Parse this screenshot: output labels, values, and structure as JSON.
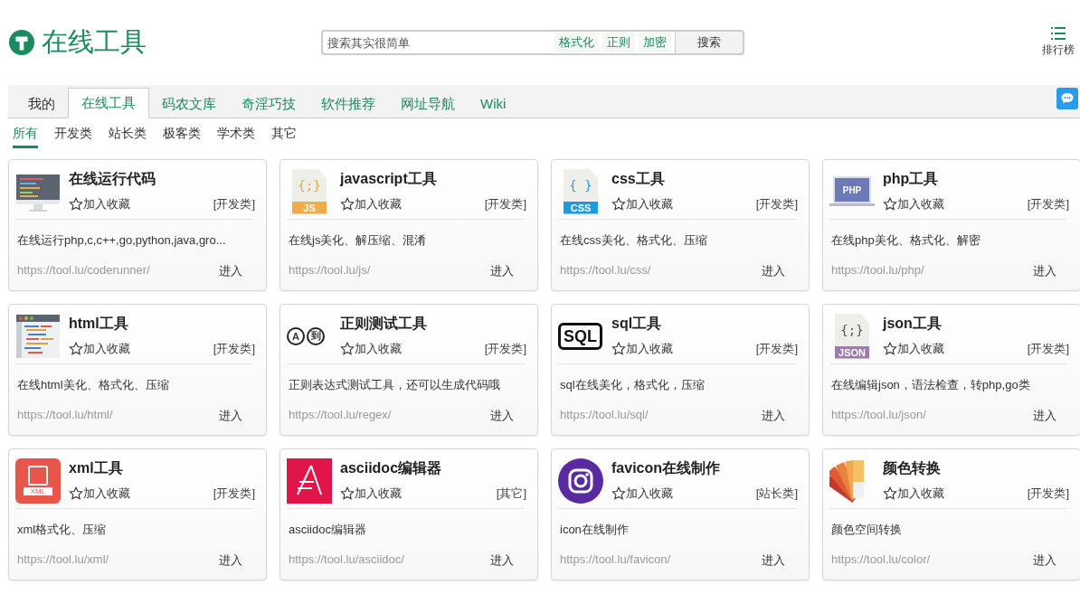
{
  "logo": {
    "title": "在线工具"
  },
  "search": {
    "placeholder": "搜索其实很简单",
    "tags": [
      "格式化",
      "正则",
      "加密"
    ],
    "button": "搜索"
  },
  "ranking": {
    "label": "排行榜"
  },
  "tabs": [
    {
      "label": "我的",
      "selected": false
    },
    {
      "label": "在线工具",
      "selected": true
    },
    {
      "label": "码农文库",
      "selected": false
    },
    {
      "label": "奇淫巧技",
      "selected": false
    },
    {
      "label": "软件推荐",
      "selected": false
    },
    {
      "label": "网址导航",
      "selected": false
    },
    {
      "label": "Wiki",
      "selected": false
    }
  ],
  "filters": [
    {
      "label": "所有",
      "selected": true
    },
    {
      "label": "开发类",
      "selected": false
    },
    {
      "label": "站长类",
      "selected": false
    },
    {
      "label": "极客类",
      "selected": false
    },
    {
      "label": "学术类",
      "selected": false
    },
    {
      "label": "其它",
      "selected": false
    }
  ],
  "cards": [
    {
      "title": "在线运行代码",
      "favorite": "加入收藏",
      "category": "[开发类]",
      "description": "在线运行php,c,c++,go,python,java,gro...",
      "url": "https://tool.lu/coderunner/",
      "enter": "进入"
    },
    {
      "title": "javascript工具",
      "icon_labels": [
        "{;}",
        "JS"
      ],
      "favorite": "加入收藏",
      "category": "[开发类]",
      "description": "在线js美化、解压缩、混淆",
      "url": "https://tool.lu/js/",
      "enter": "进入"
    },
    {
      "title": "css工具",
      "icon_labels": [
        "{ }",
        "CSS"
      ],
      "favorite": "加入收藏",
      "category": "[开发类]",
      "description": "在线css美化、格式化、压缩",
      "url": "https://tool.lu/css/",
      "enter": "进入"
    },
    {
      "title": "php工具",
      "icon_labels": [
        "PHP"
      ],
      "favorite": "加入收藏",
      "category": "[开发类]",
      "description": "在线php美化、格式化、解密",
      "url": "https://tool.lu/php/",
      "enter": "进入"
    },
    {
      "title": "html工具",
      "favorite": "加入收藏",
      "category": "[开发类]",
      "description": "在线html美化、格式化、压缩",
      "url": "https://tool.lu/html/",
      "enter": "进入"
    },
    {
      "title": "正则测试工具",
      "icon_labels": [
        "A",
        "到"
      ],
      "favorite": "加入收藏",
      "category": "[开发类]",
      "description": "正则表达式测试工具，还可以生成代码哦",
      "url": "https://tool.lu/regex/",
      "enter": "进入"
    },
    {
      "title": "sql工具",
      "icon_labels": [
        "SQL"
      ],
      "favorite": "加入收藏",
      "category": "[开发类]",
      "description": "sql在线美化，格式化，压缩",
      "url": "https://tool.lu/sql/",
      "enter": "进入"
    },
    {
      "title": "json工具",
      "icon_labels": [
        "{;}",
        "JSON"
      ],
      "favorite": "加入收藏",
      "category": "[开发类]",
      "description": "在线编辑json，语法检查，转php,go类",
      "url": "https://tool.lu/json/",
      "enter": "进入"
    },
    {
      "title": "xml工具",
      "icon_labels": [
        "XML"
      ],
      "favorite": "加入收藏",
      "category": "[开发类]",
      "description": "xml格式化、压缩",
      "url": "https://tool.lu/xml/",
      "enter": "进入"
    },
    {
      "title": "asciidoc编辑器",
      "favorite": "加入收藏",
      "category": "[其它]",
      "description": "asciidoc编辑器",
      "url": "https://tool.lu/asciidoc/",
      "enter": "进入"
    },
    {
      "title": "favicon在线制作",
      "favorite": "加入收藏",
      "category": "[站长类]",
      "description": "icon在线制作",
      "url": "https://tool.lu/favicon/",
      "enter": "进入"
    },
    {
      "title": "颜色转换",
      "favorite": "加入收藏",
      "category": "[开发类]",
      "description": "颜色空间转换",
      "url": "https://tool.lu/color/",
      "enter": "进入"
    }
  ]
}
